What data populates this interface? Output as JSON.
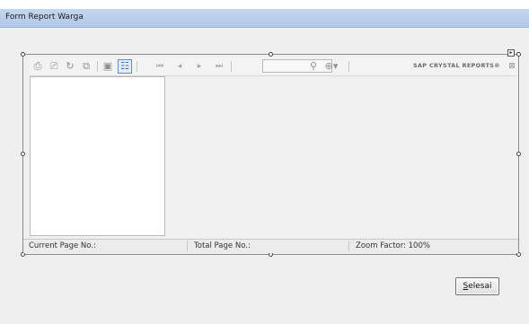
{
  "window": {
    "title": "Form Report Warga"
  },
  "viewer": {
    "brand_label": "SAP CRYSTAL REPORTS®",
    "toolbar_icons": [
      "export-icon",
      "print-icon",
      "refresh-icon",
      "copy-icon",
      "toggle-parameter-panel-icon",
      "toggle-group-tree-icon",
      "first-page-icon",
      "previous-page-icon",
      "next-page-icon",
      "last-page-icon",
      "find-icon",
      "zoom-icon"
    ],
    "goto_page_value": "",
    "status": {
      "current_page_label": "Current Page No.:",
      "total_page_label": "Total Page No.:",
      "zoom_label": "Zoom Factor: 100%"
    }
  },
  "buttons": {
    "selesai_underlined": "S",
    "selesai_rest": "elesai"
  }
}
